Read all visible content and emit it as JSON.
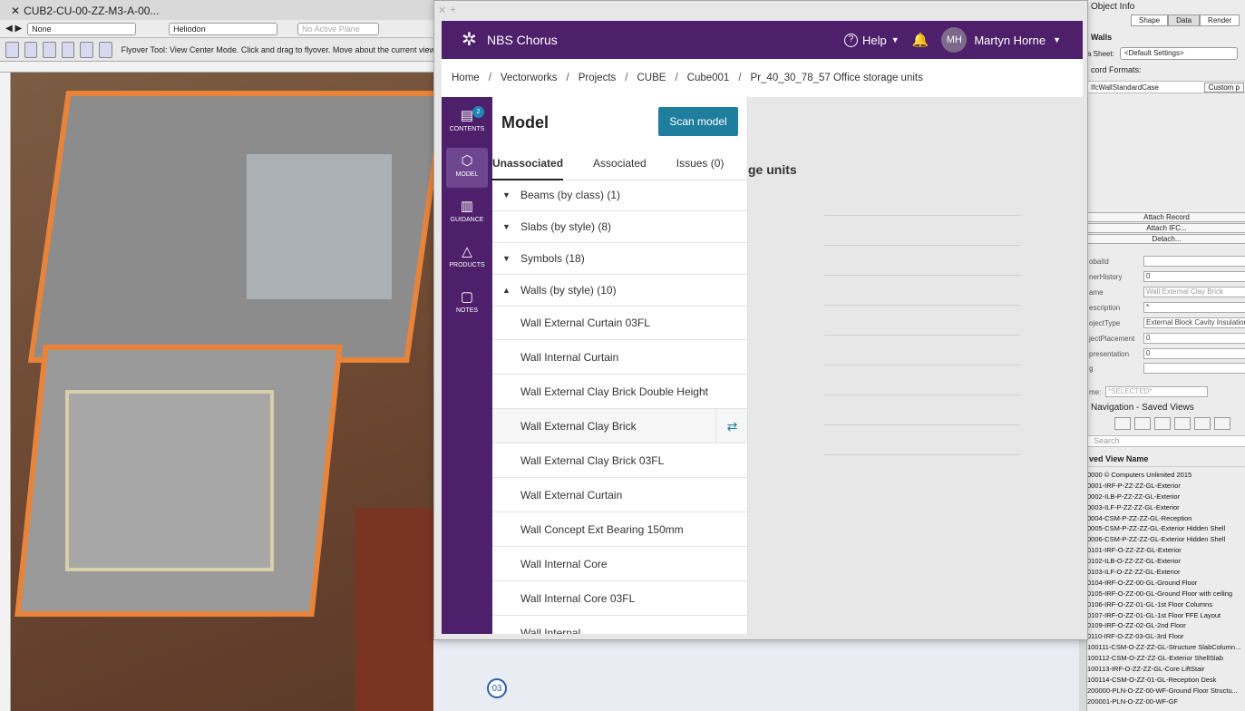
{
  "vw": {
    "tab_title": "CUB2-CU-00-ZZ-M3-A-00...",
    "class_select": "None",
    "render_select": "Heliodon",
    "plane_select": "No Active Plane",
    "hint": "Flyover Tool: View Center Mode. Click and drag to flyover.  Move about the current view",
    "marker": "03"
  },
  "object_info": {
    "title": "Object Info",
    "tabs": [
      "Shape",
      "Data",
      "Render"
    ],
    "class_name": "Walls",
    "data_sheet_label": "a Sheet:",
    "data_sheet_value": "<Default Settings>",
    "record_formats_label": "cord Formats:",
    "ifc_record": "IfcWallStandardCase",
    "custom_button": "Custom p",
    "attach_record": "Attach Record",
    "attach_ifc": "Attach IFC...",
    "detach": "Detach...",
    "props": [
      {
        "label": "obalId",
        "value": ""
      },
      {
        "label": "nerHistory",
        "value": "0"
      },
      {
        "label": "ame",
        "value": "Wall External Clay Brick"
      },
      {
        "label": "escription",
        "value": "*"
      },
      {
        "label": "ojectType",
        "value": "External Block Cavity Insulation"
      },
      {
        "label": "jectPlacement",
        "value": "0"
      },
      {
        "label": "presentation",
        "value": "0"
      },
      {
        "label": "g",
        "value": ""
      },
      {
        "label": "me:",
        "value": "*SELECTED*"
      }
    ]
  },
  "nav": {
    "title": "Navigation - Saved Views",
    "search_placeholder": "Search",
    "column_header": "ved View Name",
    "rows": [
      "0000 © Computers Unlimited 2015",
      "0001-IRF-P-ZZ-ZZ-GL-Exterior",
      "0002-ILB-P-ZZ-ZZ-GL-Exterior",
      "0003-ILF-P-ZZ-ZZ-GL-Exterior",
      "0004-CSM-P-ZZ-ZZ-GL-Reception",
      "0005-CSM-P-ZZ-ZZ-GL-Exterior Hidden Shell",
      "0006-CSM-P-ZZ-ZZ-GL-Exterior Hidden Shell",
      "0101-IRF-O-ZZ-ZZ-GL-Exterior",
      "0102-ILB-O-ZZ-ZZ-GL-Exterior",
      "0103-ILF-O-ZZ-ZZ-GL-Exterior",
      "0104-IRF-O-ZZ-00-GL-Ground Floor",
      "0105-IRF-O-ZZ-00-GL-Ground Floor with ceiling",
      "0106-IRF-O-ZZ-01-GL-1st Floor Columns",
      "0107-IRF-O-ZZ-01-GL-1st Floor FFE Layout",
      "0109-IRF-O-ZZ-02-GL-2nd Floor",
      "0110-IRF-O-ZZ-03-GL-3rd Floor",
      "100111-CSM-O-ZZ-ZZ-GL-Structure SlabColumn...",
      "100112-CSM-O-ZZ-ZZ-GL-Exterior ShellSlab",
      "100113-IRF-O-ZZ-ZZ-GL-Core LiftStair",
      "100114-CSM-O-ZZ-01-GL-Reception Desk",
      "200000-PLN-O-ZZ-00-WF-Ground Floor Structu...",
      "200001-PLN-O-ZZ-00-WF-GF"
    ]
  },
  "chorus": {
    "brand": "NBS Chorus",
    "help": "Help",
    "user_initials": "MH",
    "user_name": "Martyn Horne",
    "breadcrumb": [
      "Home",
      "Vectorworks",
      "Projects",
      "CUBE",
      "Cube001",
      "Pr_40_30_78_57 Office storage units"
    ],
    "sidenav": [
      {
        "label": "CONTENTS",
        "badge": "2"
      },
      {
        "label": "MODEL"
      },
      {
        "label": "GUIDANCE"
      },
      {
        "label": "PRODUCTS"
      },
      {
        "label": "NOTES"
      }
    ],
    "model": {
      "title": "Model",
      "scan_button": "Scan model",
      "tabs": [
        "Unassociated",
        "Associated",
        "Issues (0)"
      ],
      "groups": [
        "Beams (by class) (1)",
        "Slabs (by style) (8)",
        "Symbols (18)",
        "Walls (by style) (10)"
      ],
      "items": [
        "Wall External Curtain 03FL",
        "Wall Internal Curtain",
        "Wall External Clay Brick Double Height",
        "Wall External Clay Brick",
        "Wall External Clay Brick 03FL",
        "Wall External Curtain",
        "Wall Concept Ext Bearing 150mm",
        "Wall Internal Core",
        "Wall Internal Core 03FL",
        "Wall Internal"
      ]
    },
    "detail_title_fragment": "ge units"
  },
  "colors": {
    "purple": "#4e1f6a",
    "teal": "#1f7e9e",
    "orange": "#e8833a"
  },
  "icons": [
    "close-icon",
    "help-icon",
    "bell-icon",
    "caret-down-icon",
    "contents-icon",
    "cube-icon",
    "book-icon",
    "shapes-icon",
    "note-icon",
    "swap-icon",
    "triangle-icon"
  ]
}
